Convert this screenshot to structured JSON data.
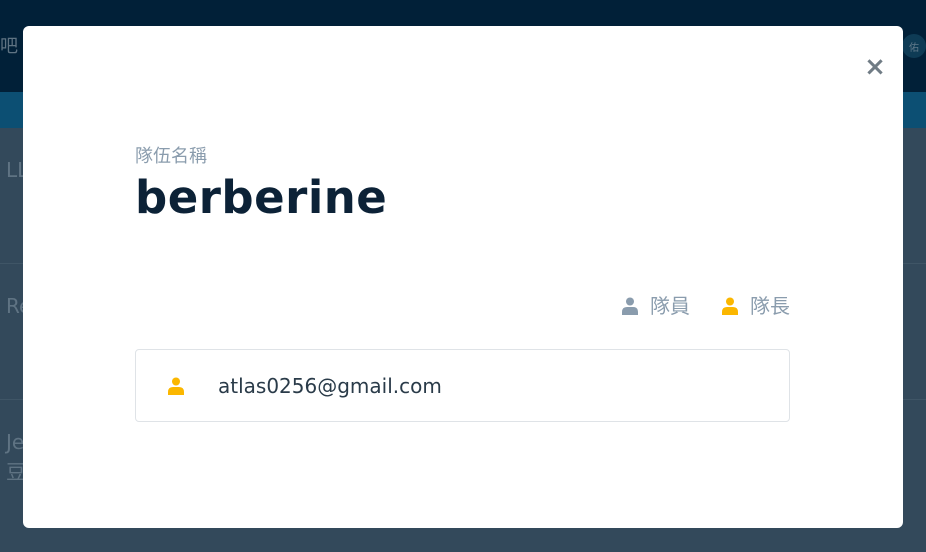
{
  "background": {
    "header_left": "吧",
    "header_right_avatar": "佑",
    "rows": [
      "LL",
      "Re",
      "Je",
      "豆"
    ]
  },
  "modal": {
    "close_label": "×",
    "team_label": "隊伍名稱",
    "team_name": "berberine",
    "legend": {
      "member_label": "隊員",
      "captain_label": "隊長"
    },
    "members": [
      {
        "email": "atlas0256@gmail.com",
        "role": "captain"
      }
    ]
  },
  "colors": {
    "member_icon": "#8a9cad",
    "captain_icon": "#fbb700",
    "title": "#0c2237"
  },
  "icons": {
    "member": "user-icon",
    "captain": "user-icon",
    "close": "close-icon"
  }
}
